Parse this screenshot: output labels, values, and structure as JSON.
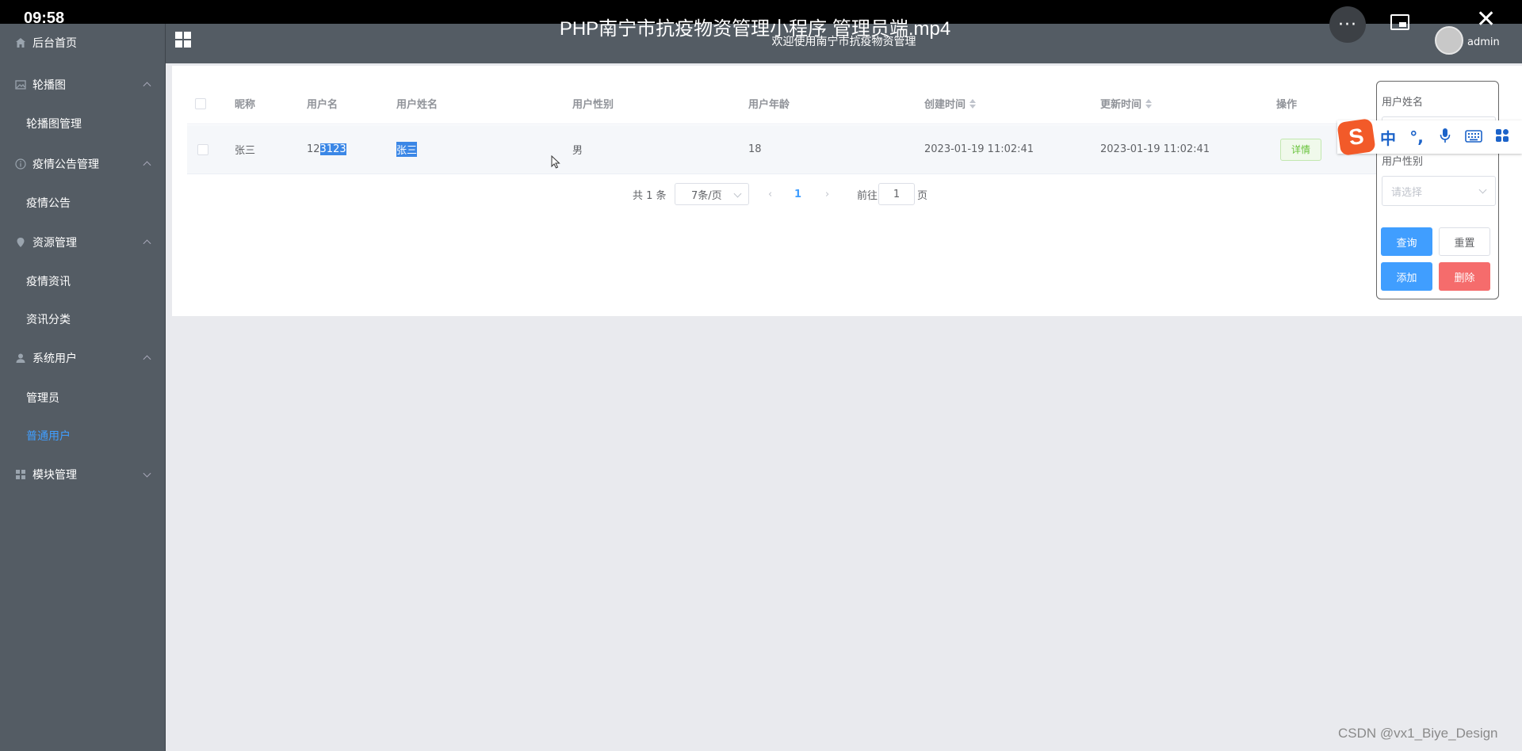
{
  "video": {
    "time": "09:58",
    "title": "PHP南宁市抗疫物资管理小程序 管理员端.mp4",
    "more_glyph": "···",
    "close_glyph": "✕"
  },
  "header": {
    "welcome": "欢迎使用南宁市抗疫物资管理",
    "user": "admin"
  },
  "sidebar": {
    "items": [
      {
        "label": "后台首页",
        "icon": "home-icon"
      },
      {
        "label": "轮播图",
        "icon": "image-icon"
      },
      {
        "label": "轮播图管理"
      },
      {
        "label": "疫情公告管理",
        "icon": "info-icon"
      },
      {
        "label": "疫情公告"
      },
      {
        "label": "资源管理",
        "icon": "location-icon"
      },
      {
        "label": "疫情资讯"
      },
      {
        "label": "资讯分类"
      },
      {
        "label": "系统用户",
        "icon": "user-icon"
      },
      {
        "label": "管理员"
      },
      {
        "label": "普通用户"
      },
      {
        "label": "模块管理",
        "icon": "grid-icon"
      }
    ]
  },
  "table": {
    "columns": [
      "昵称",
      "用户名",
      "用户姓名",
      "用户性别",
      "用户年龄",
      "创建时间",
      "更新时间",
      "操作"
    ],
    "row": {
      "nickname": "张三",
      "username_prefix": "12",
      "username_selected": "3123",
      "realname": "张三",
      "gender": "男",
      "age": "18",
      "created": "2023-01-19 11:02:41",
      "updated": "2023-01-19 11:02:41",
      "action": "详情"
    }
  },
  "pager": {
    "total": "共 1 条",
    "page_size": "7条/页",
    "current": "1",
    "goto_prefix": "前往",
    "goto_value": "1",
    "goto_suffix": "页"
  },
  "search": {
    "name_label": "用户姓名",
    "gender_label": "用户性别",
    "gender_placeholder": "请选择",
    "query": "查询",
    "reset": "重置",
    "add": "添加",
    "delete": "删除"
  },
  "ime": {
    "logo": "S",
    "lang": "中",
    "punct": "°,"
  },
  "watermark": "CSDN @vx1_Biye_Design"
}
